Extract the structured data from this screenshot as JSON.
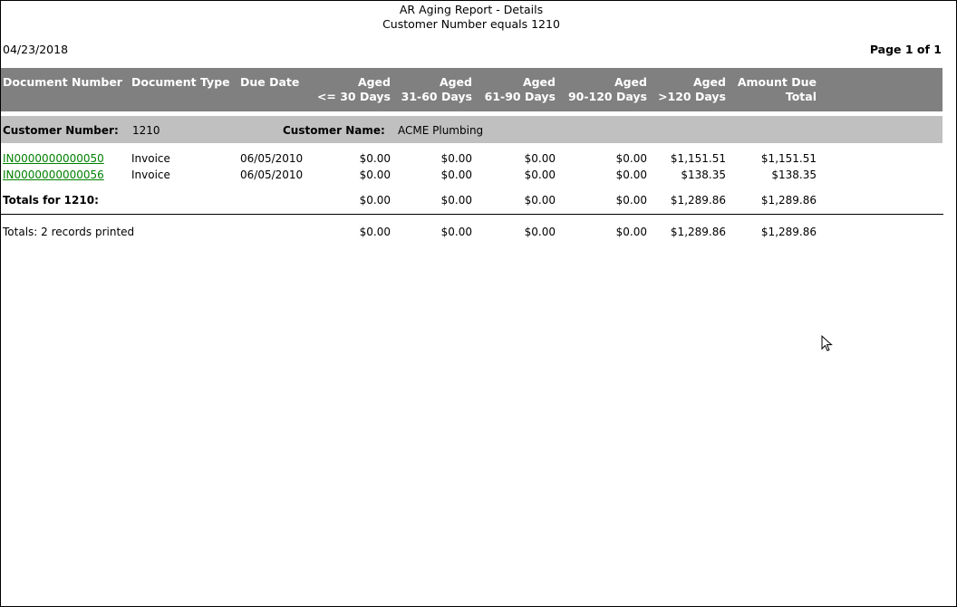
{
  "report": {
    "title": "AR Aging Report - Details",
    "subtitle": "Customer Number equals 1210",
    "date": "04/23/2018",
    "page": "Page 1 of 1"
  },
  "columns": {
    "doc_number": "Document Number",
    "doc_type": "Document Type",
    "due_date": "Due Date",
    "aged30_1": "Aged",
    "aged30_2": "<= 30 Days",
    "aged60_1": "Aged",
    "aged60_2": "31-60 Days",
    "aged90_1": "Aged",
    "aged90_2": "61-90 Days",
    "aged120_1": "Aged",
    "aged120_2": "90-120 Days",
    "agedover_1": "Aged",
    "agedover_2": ">120 Days",
    "amount_1": "Amount Due",
    "amount_2": "Total"
  },
  "customer": {
    "number_label": "Customer Number:",
    "number": "1210",
    "name_label": "Customer Name:",
    "name": "ACME Plumbing"
  },
  "rows": [
    {
      "doc": "IN0000000000050",
      "type": "Invoice",
      "due": "06/05/2010",
      "a30": "$0.00",
      "a60": "$0.00",
      "a90": "$0.00",
      "a120": "$0.00",
      "aover": "$1,151.51",
      "total": "$1,151.51"
    },
    {
      "doc": "IN0000000000056",
      "type": "Invoice",
      "due": "06/05/2010",
      "a30": "$0.00",
      "a60": "$0.00",
      "a90": "$0.00",
      "a120": "$0.00",
      "aover": "$138.35",
      "total": "$138.35"
    }
  ],
  "customer_totals": {
    "label": "Totals for 1210:",
    "a30": "$0.00",
    "a60": "$0.00",
    "a90": "$0.00",
    "a120": "$0.00",
    "aover": "$1,289.86",
    "total": "$1,289.86"
  },
  "grand_totals": {
    "label": "Totals: 2 records printed",
    "a30": "$0.00",
    "a60": "$0.00",
    "a90": "$0.00",
    "a120": "$0.00",
    "aover": "$1,289.86",
    "total": "$1,289.86"
  }
}
